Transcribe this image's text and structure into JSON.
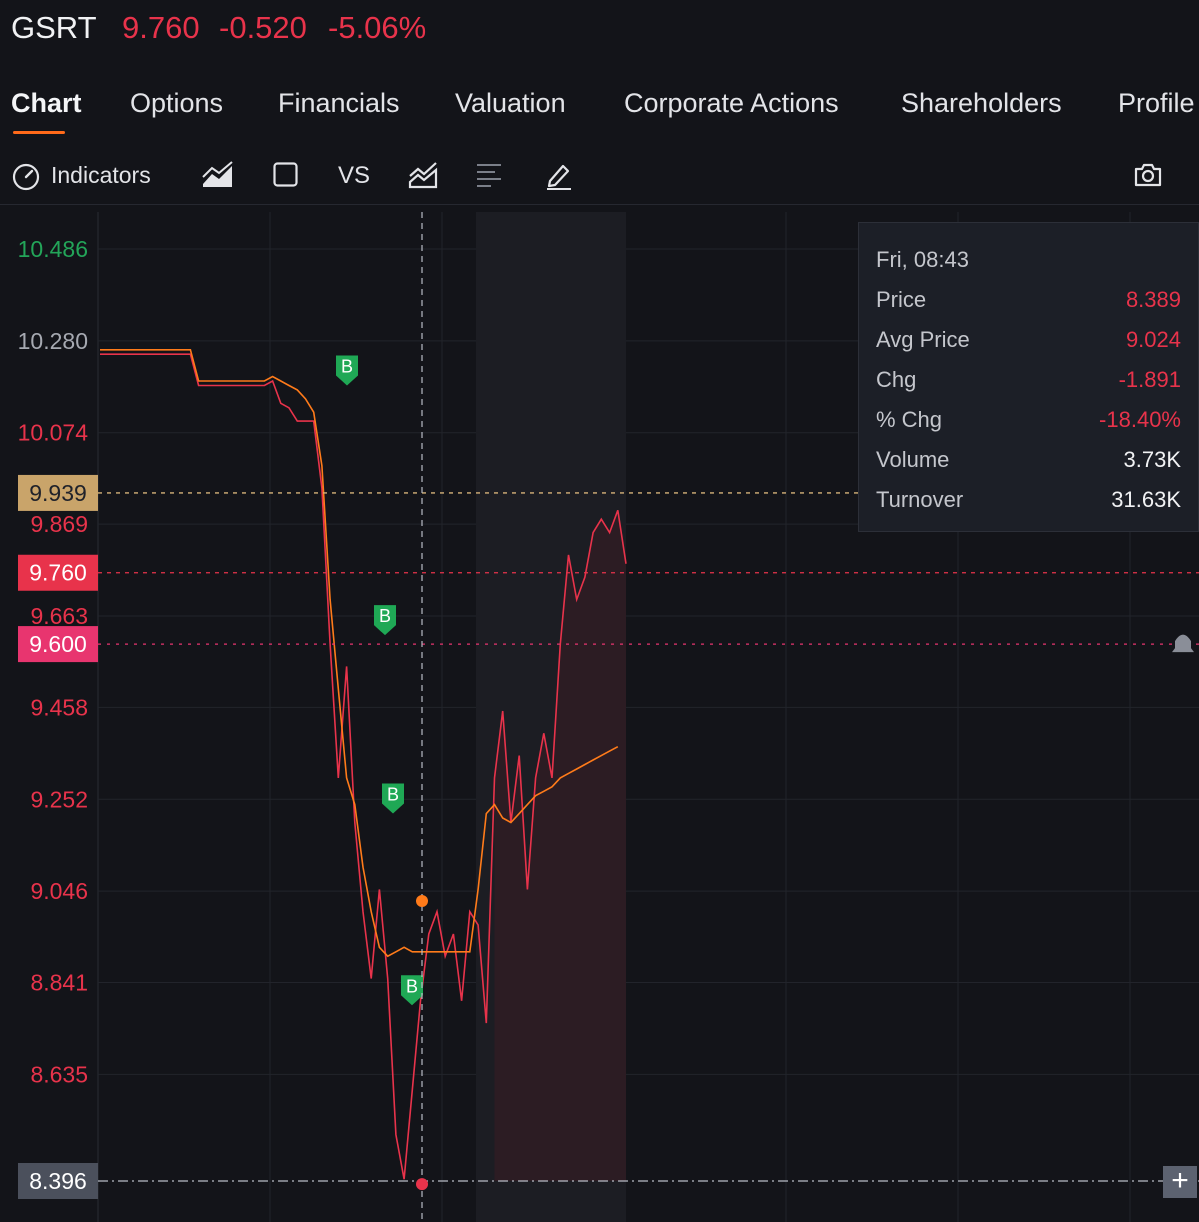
{
  "header": {
    "ticker": "GSRT",
    "price": "9.760",
    "change": "-0.520",
    "change_pct": "-5.06%"
  },
  "tabs": [
    "Chart",
    "Options",
    "Financials",
    "Valuation",
    "Corporate Actions",
    "Shareholders",
    "Profile"
  ],
  "toolbar": {
    "indicators_label": "Indicators",
    "vs_label": "VS",
    "icons": [
      "indicators-gauge-icon",
      "chart-type-area-icon",
      "rectangle-icon",
      "compare-chart-icon",
      "list-lines-icon",
      "draw-pen-icon",
      "camera-icon"
    ]
  },
  "tooltip": {
    "time": "Fri, 08:43",
    "rows": [
      {
        "label": "Price",
        "value": "8.389",
        "color": "red"
      },
      {
        "label": "Avg Price",
        "value": "9.024",
        "color": "red"
      },
      {
        "label": "Chg",
        "value": "-1.891",
        "color": "red"
      },
      {
        "label": "% Chg",
        "value": "-18.40%",
        "color": "red"
      },
      {
        "label": "Volume",
        "value": "3.73K",
        "color": "white"
      },
      {
        "label": "Turnover",
        "value": "31.63K",
        "color": "white"
      }
    ]
  },
  "colors": {
    "up": "#1f9d55",
    "down": "#e8334b",
    "avg": "#ff7b1a",
    "bg": "#131419",
    "alert": "#e8356f",
    "buy_marker": "#1fa855"
  },
  "chart_data": {
    "type": "line",
    "y_ticks": [
      {
        "label": "10.486",
        "value": 10.486,
        "color": "green"
      },
      {
        "label": "10.280",
        "value": 10.28,
        "color": "gray"
      },
      {
        "label": "10.074",
        "value": 10.074,
        "color": "red"
      },
      {
        "label": "9.869",
        "value": 9.869,
        "color": "red"
      },
      {
        "label": "9.663",
        "value": 9.663,
        "color": "red"
      },
      {
        "label": "9.458",
        "value": 9.458,
        "color": "red"
      },
      {
        "label": "9.252",
        "value": 9.252,
        "color": "red"
      },
      {
        "label": "9.046",
        "value": 9.046,
        "color": "red"
      },
      {
        "label": "8.841",
        "value": 8.841,
        "color": "red"
      },
      {
        "label": "8.635",
        "value": 8.635,
        "color": "red"
      }
    ],
    "ylim": [
      8.396,
      10.486
    ],
    "markers": [
      {
        "label": "9.939",
        "value": 9.939,
        "style": "prev-close"
      },
      {
        "label": "9.760",
        "value": 9.76,
        "style": "last-price"
      },
      {
        "label": "9.600",
        "value": 9.6,
        "style": "alert"
      },
      {
        "label": "8.396",
        "value": 8.396,
        "style": "crosshair"
      }
    ],
    "buy_label": "B",
    "buy_points": [
      10.18,
      9.62,
      9.22,
      8.79
    ],
    "series": [
      {
        "name": "Price",
        "values": [
          10.25,
          10.25,
          10.25,
          10.25,
          10.25,
          10.25,
          10.25,
          10.25,
          10.25,
          10.25,
          10.25,
          10.25,
          10.18,
          10.18,
          10.18,
          10.18,
          10.18,
          10.18,
          10.18,
          10.18,
          10.18,
          10.19,
          10.14,
          10.13,
          10.1,
          10.1,
          10.1,
          9.95,
          9.6,
          9.3,
          9.55,
          9.2,
          9.0,
          8.85,
          9.05,
          8.85,
          8.5,
          8.4,
          8.6,
          8.8,
          8.95,
          9.0,
          8.9,
          8.95,
          8.8,
          9.0,
          8.97,
          8.75,
          9.3,
          9.45,
          9.2,
          9.35,
          9.05,
          9.3,
          9.4,
          9.3,
          9.6,
          9.8,
          9.7,
          9.75,
          9.85,
          9.88,
          9.85,
          9.9,
          9.78
        ]
      },
      {
        "name": "Avg Price",
        "values": [
          10.26,
          10.26,
          10.26,
          10.26,
          10.26,
          10.26,
          10.26,
          10.26,
          10.26,
          10.26,
          10.26,
          10.26,
          10.19,
          10.19,
          10.19,
          10.19,
          10.19,
          10.19,
          10.19,
          10.19,
          10.19,
          10.2,
          10.19,
          10.18,
          10.17,
          10.15,
          10.12,
          10.0,
          9.7,
          9.5,
          9.3,
          9.24,
          9.1,
          9.0,
          8.92,
          8.9,
          8.91,
          8.92,
          8.91,
          8.91,
          8.91,
          8.91,
          8.91,
          8.91,
          8.91,
          8.91,
          9.05,
          9.22,
          9.24,
          9.21,
          9.2,
          9.22,
          9.24,
          9.26,
          9.27,
          9.28,
          9.3,
          9.31,
          9.32,
          9.33,
          9.34,
          9.35,
          9.36,
          9.37
        ]
      }
    ]
  }
}
